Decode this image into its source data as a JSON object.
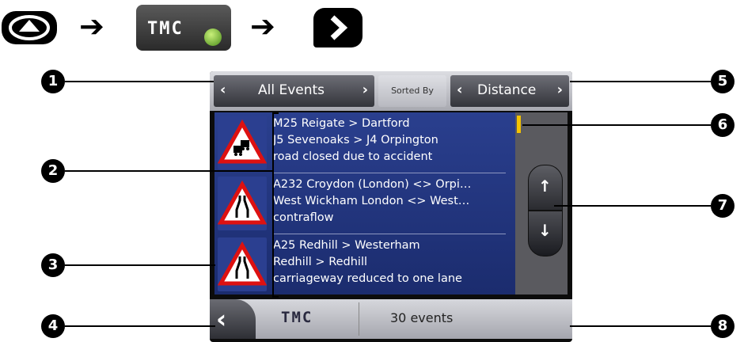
{
  "screen": {
    "sort_options": {
      "filter_label": "All Events",
      "sorted_by_label": "Sorted By",
      "sort_label": "Distance"
    },
    "events": [
      {
        "icon": "traffic-jam-sign-icon",
        "lines": [
          "M25 Reigate > Dartford",
          "J5 Sevenoaks > J4 Orpington",
          "road closed due to accident"
        ]
      },
      {
        "icon": "road-narrows-sign-icon",
        "lines": [
          "A232 Croydon (London) <> Orpi…",
          "West Wickham London <> West…",
          "contraflow"
        ]
      },
      {
        "icon": "road-narrows-sign-icon",
        "lines": [
          "A25 Redhill > Westerham",
          "Redhill > Redhill",
          "carriageway reduced to one lane"
        ]
      }
    ],
    "tmc_label": "TMC",
    "status": "30 events"
  },
  "nav_sequence": {
    "tmc_label": "TMC"
  },
  "callouts": [
    "1",
    "2",
    "3",
    "4",
    "5",
    "6",
    "7",
    "8"
  ]
}
